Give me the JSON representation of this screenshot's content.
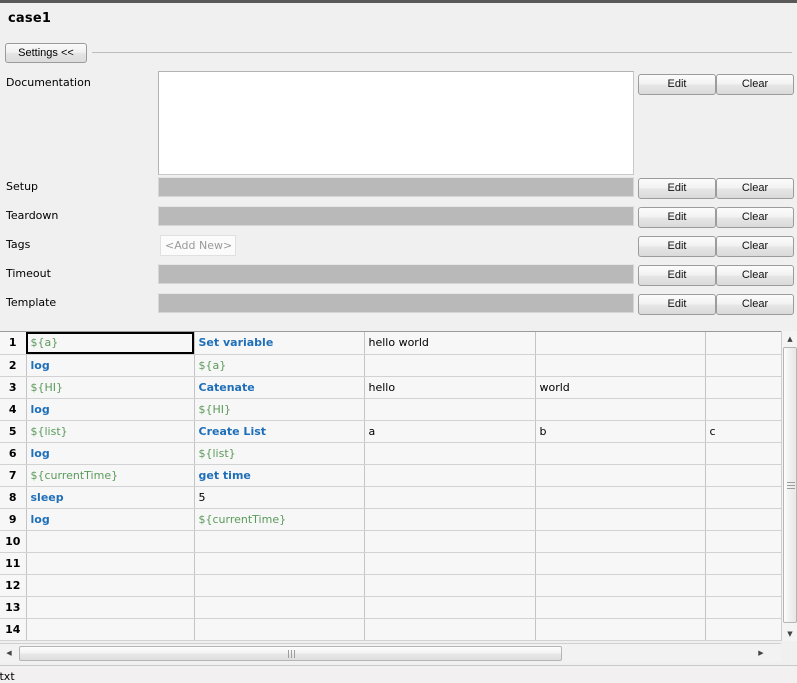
{
  "window": {
    "title": "case1"
  },
  "toolbar": {
    "settings_toggle_label": "Settings <<"
  },
  "settings": {
    "edit_label": "Edit",
    "clear_label": "Clear",
    "fields": [
      {
        "label": "Documentation",
        "value": "",
        "type": "textarea"
      },
      {
        "label": "Setup",
        "value": "",
        "type": "disabled-text"
      },
      {
        "label": "Teardown",
        "value": "",
        "type": "disabled-text"
      },
      {
        "label": "Tags",
        "value": "<Add New>",
        "type": "tags"
      },
      {
        "label": "Timeout",
        "value": "",
        "type": "disabled-text"
      },
      {
        "label": "Template",
        "value": "",
        "type": "disabled-text"
      }
    ]
  },
  "grid": {
    "selected_cell": {
      "row": 1,
      "col": 1
    },
    "rows": [
      {
        "num": "1",
        "cells": [
          {
            "text": "${a}",
            "style": "var",
            "state": "normal"
          },
          {
            "text": "Set variable",
            "style": "kw",
            "state": "normal"
          },
          {
            "text": "hello world",
            "style": "plain",
            "state": "normal"
          },
          {
            "text": "",
            "style": "plain",
            "state": "normal"
          },
          {
            "text": "",
            "style": "plain",
            "state": "normal"
          }
        ]
      },
      {
        "num": "2",
        "cells": [
          {
            "text": "log",
            "style": "kw",
            "state": "normal"
          },
          {
            "text": "${a}",
            "style": "var",
            "state": "normal"
          },
          {
            "text": "",
            "style": "plain",
            "state": "normal"
          },
          {
            "text": "",
            "style": "plain",
            "state": "normal"
          },
          {
            "text": "",
            "style": "plain",
            "state": "normal"
          }
        ]
      },
      {
        "num": "3",
        "cells": [
          {
            "text": "${HI}",
            "style": "var",
            "state": "normal"
          },
          {
            "text": "Catenate",
            "style": "kw",
            "state": "normal"
          },
          {
            "text": "hello",
            "style": "plain",
            "state": "normal"
          },
          {
            "text": "world",
            "style": "plain",
            "state": "normal"
          },
          {
            "text": "",
            "style": "plain",
            "state": "normal"
          }
        ]
      },
      {
        "num": "4",
        "cells": [
          {
            "text": "log",
            "style": "kw",
            "state": "normal"
          },
          {
            "text": "${HI}",
            "style": "var",
            "state": "normal"
          },
          {
            "text": "",
            "style": "plain",
            "state": "normal"
          },
          {
            "text": "",
            "style": "plain",
            "state": "normal"
          },
          {
            "text": "",
            "style": "plain",
            "state": "normal"
          }
        ]
      },
      {
        "num": "5",
        "cells": [
          {
            "text": "${list}",
            "style": "var",
            "state": "normal"
          },
          {
            "text": "Create List",
            "style": "kw",
            "state": "normal"
          },
          {
            "text": "a",
            "style": "plain",
            "state": "normal"
          },
          {
            "text": "b",
            "style": "plain",
            "state": "normal"
          },
          {
            "text": "c",
            "style": "plain",
            "state": "normal"
          }
        ]
      },
      {
        "num": "6",
        "cells": [
          {
            "text": "log",
            "style": "kw",
            "state": "normal"
          },
          {
            "text": "${list}",
            "style": "var",
            "state": "normal"
          },
          {
            "text": "",
            "style": "plain",
            "state": "normal"
          },
          {
            "text": "",
            "style": "plain",
            "state": "normal"
          },
          {
            "text": "",
            "style": "plain",
            "state": "normal"
          }
        ]
      },
      {
        "num": "7",
        "cells": [
          {
            "text": "${currentTime}",
            "style": "var",
            "state": "normal"
          },
          {
            "text": "get time",
            "style": "kw",
            "state": "normal"
          },
          {
            "text": "",
            "style": "plain",
            "state": "normal"
          },
          {
            "text": "",
            "style": "plain",
            "state": "normal"
          },
          {
            "text": "",
            "style": "plain",
            "state": "disabled"
          }
        ]
      },
      {
        "num": "8",
        "cells": [
          {
            "text": "sleep",
            "style": "kw",
            "state": "normal"
          },
          {
            "text": "5",
            "style": "plain",
            "state": "normal"
          },
          {
            "text": "",
            "style": "plain",
            "state": "normal"
          },
          {
            "text": "",
            "style": "plain",
            "state": "disabled"
          },
          {
            "text": "",
            "style": "plain",
            "state": "disabled"
          }
        ]
      },
      {
        "num": "9",
        "cells": [
          {
            "text": "log",
            "style": "kw",
            "state": "normal"
          },
          {
            "text": "${currentTime}",
            "style": "var",
            "state": "normal"
          },
          {
            "text": "",
            "style": "plain",
            "state": "normal"
          },
          {
            "text": "",
            "style": "plain",
            "state": "normal"
          },
          {
            "text": "",
            "style": "plain",
            "state": "normal"
          }
        ]
      },
      {
        "num": "10",
        "cells": [
          {
            "text": "",
            "style": "plain",
            "state": "normal"
          },
          {
            "text": "",
            "style": "plain",
            "state": "normal"
          },
          {
            "text": "",
            "style": "plain",
            "state": "normal"
          },
          {
            "text": "",
            "style": "plain",
            "state": "normal"
          },
          {
            "text": "",
            "style": "plain",
            "state": "normal"
          }
        ]
      },
      {
        "num": "11",
        "cells": [
          {
            "text": "",
            "style": "plain",
            "state": "normal"
          },
          {
            "text": "",
            "style": "plain",
            "state": "normal"
          },
          {
            "text": "",
            "style": "plain",
            "state": "normal"
          },
          {
            "text": "",
            "style": "plain",
            "state": "normal"
          },
          {
            "text": "",
            "style": "plain",
            "state": "normal"
          }
        ]
      },
      {
        "num": "12",
        "cells": [
          {
            "text": "",
            "style": "plain",
            "state": "normal"
          },
          {
            "text": "",
            "style": "plain",
            "state": "normal"
          },
          {
            "text": "",
            "style": "plain",
            "state": "normal"
          },
          {
            "text": "",
            "style": "plain",
            "state": "normal"
          },
          {
            "text": "",
            "style": "plain",
            "state": "normal"
          }
        ]
      },
      {
        "num": "13",
        "cells": [
          {
            "text": "",
            "style": "plain",
            "state": "normal"
          },
          {
            "text": "",
            "style": "plain",
            "state": "normal"
          },
          {
            "text": "",
            "style": "plain",
            "state": "normal"
          },
          {
            "text": "",
            "style": "plain",
            "state": "normal"
          },
          {
            "text": "",
            "style": "plain",
            "state": "normal"
          }
        ]
      },
      {
        "num": "14",
        "cells": [
          {
            "text": "",
            "style": "plain",
            "state": "normal"
          },
          {
            "text": "",
            "style": "plain",
            "state": "normal"
          },
          {
            "text": "",
            "style": "plain",
            "state": "normal"
          },
          {
            "text": "",
            "style": "plain",
            "state": "normal"
          },
          {
            "text": "",
            "style": "plain",
            "state": "normal"
          }
        ]
      }
    ]
  },
  "scrollbars": {
    "vertical": {
      "up_arrow": "▲",
      "down_arrow": "▼"
    },
    "horizontal": {
      "left_arrow": "◀",
      "right_arrow": "▶"
    }
  },
  "status": {
    "text": ".txt"
  },
  "colors": {
    "keyword": "#1f6fb8",
    "variable": "#5a9a5a",
    "disabled_cell": "#c0c0c0",
    "panel_bg": "#f0f0f0",
    "field_gray": "#b9b9b9"
  }
}
